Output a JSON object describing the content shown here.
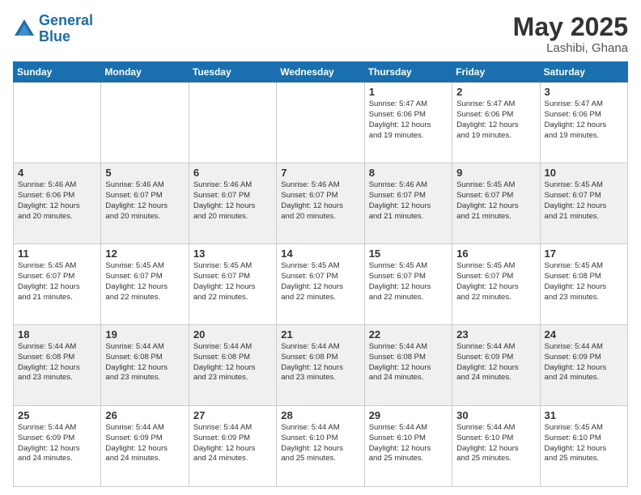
{
  "logo": {
    "line1": "General",
    "line2": "Blue"
  },
  "title": "May 2025",
  "location": "Lashibi, Ghana",
  "days_of_week": [
    "Sunday",
    "Monday",
    "Tuesday",
    "Wednesday",
    "Thursday",
    "Friday",
    "Saturday"
  ],
  "weeks": [
    [
      {
        "day": "",
        "info": ""
      },
      {
        "day": "",
        "info": ""
      },
      {
        "day": "",
        "info": ""
      },
      {
        "day": "",
        "info": ""
      },
      {
        "day": "1",
        "info": "Sunrise: 5:47 AM\nSunset: 6:06 PM\nDaylight: 12 hours\nand 19 minutes."
      },
      {
        "day": "2",
        "info": "Sunrise: 5:47 AM\nSunset: 6:06 PM\nDaylight: 12 hours\nand 19 minutes."
      },
      {
        "day": "3",
        "info": "Sunrise: 5:47 AM\nSunset: 6:06 PM\nDaylight: 12 hours\nand 19 minutes."
      }
    ],
    [
      {
        "day": "4",
        "info": "Sunrise: 5:46 AM\nSunset: 6:06 PM\nDaylight: 12 hours\nand 20 minutes."
      },
      {
        "day": "5",
        "info": "Sunrise: 5:46 AM\nSunset: 6:07 PM\nDaylight: 12 hours\nand 20 minutes."
      },
      {
        "day": "6",
        "info": "Sunrise: 5:46 AM\nSunset: 6:07 PM\nDaylight: 12 hours\nand 20 minutes."
      },
      {
        "day": "7",
        "info": "Sunrise: 5:46 AM\nSunset: 6:07 PM\nDaylight: 12 hours\nand 20 minutes."
      },
      {
        "day": "8",
        "info": "Sunrise: 5:46 AM\nSunset: 6:07 PM\nDaylight: 12 hours\nand 21 minutes."
      },
      {
        "day": "9",
        "info": "Sunrise: 5:45 AM\nSunset: 6:07 PM\nDaylight: 12 hours\nand 21 minutes."
      },
      {
        "day": "10",
        "info": "Sunrise: 5:45 AM\nSunset: 6:07 PM\nDaylight: 12 hours\nand 21 minutes."
      }
    ],
    [
      {
        "day": "11",
        "info": "Sunrise: 5:45 AM\nSunset: 6:07 PM\nDaylight: 12 hours\nand 21 minutes."
      },
      {
        "day": "12",
        "info": "Sunrise: 5:45 AM\nSunset: 6:07 PM\nDaylight: 12 hours\nand 22 minutes."
      },
      {
        "day": "13",
        "info": "Sunrise: 5:45 AM\nSunset: 6:07 PM\nDaylight: 12 hours\nand 22 minutes."
      },
      {
        "day": "14",
        "info": "Sunrise: 5:45 AM\nSunset: 6:07 PM\nDaylight: 12 hours\nand 22 minutes."
      },
      {
        "day": "15",
        "info": "Sunrise: 5:45 AM\nSunset: 6:07 PM\nDaylight: 12 hours\nand 22 minutes."
      },
      {
        "day": "16",
        "info": "Sunrise: 5:45 AM\nSunset: 6:07 PM\nDaylight: 12 hours\nand 22 minutes."
      },
      {
        "day": "17",
        "info": "Sunrise: 5:45 AM\nSunset: 6:08 PM\nDaylight: 12 hours\nand 23 minutes."
      }
    ],
    [
      {
        "day": "18",
        "info": "Sunrise: 5:44 AM\nSunset: 6:08 PM\nDaylight: 12 hours\nand 23 minutes."
      },
      {
        "day": "19",
        "info": "Sunrise: 5:44 AM\nSunset: 6:08 PM\nDaylight: 12 hours\nand 23 minutes."
      },
      {
        "day": "20",
        "info": "Sunrise: 5:44 AM\nSunset: 6:08 PM\nDaylight: 12 hours\nand 23 minutes."
      },
      {
        "day": "21",
        "info": "Sunrise: 5:44 AM\nSunset: 6:08 PM\nDaylight: 12 hours\nand 23 minutes."
      },
      {
        "day": "22",
        "info": "Sunrise: 5:44 AM\nSunset: 6:08 PM\nDaylight: 12 hours\nand 24 minutes."
      },
      {
        "day": "23",
        "info": "Sunrise: 5:44 AM\nSunset: 6:09 PM\nDaylight: 12 hours\nand 24 minutes."
      },
      {
        "day": "24",
        "info": "Sunrise: 5:44 AM\nSunset: 6:09 PM\nDaylight: 12 hours\nand 24 minutes."
      }
    ],
    [
      {
        "day": "25",
        "info": "Sunrise: 5:44 AM\nSunset: 6:09 PM\nDaylight: 12 hours\nand 24 minutes."
      },
      {
        "day": "26",
        "info": "Sunrise: 5:44 AM\nSunset: 6:09 PM\nDaylight: 12 hours\nand 24 minutes."
      },
      {
        "day": "27",
        "info": "Sunrise: 5:44 AM\nSunset: 6:09 PM\nDaylight: 12 hours\nand 24 minutes."
      },
      {
        "day": "28",
        "info": "Sunrise: 5:44 AM\nSunset: 6:10 PM\nDaylight: 12 hours\nand 25 minutes."
      },
      {
        "day": "29",
        "info": "Sunrise: 5:44 AM\nSunset: 6:10 PM\nDaylight: 12 hours\nand 25 minutes."
      },
      {
        "day": "30",
        "info": "Sunrise: 5:44 AM\nSunset: 6:10 PM\nDaylight: 12 hours\nand 25 minutes."
      },
      {
        "day": "31",
        "info": "Sunrise: 5:45 AM\nSunset: 6:10 PM\nDaylight: 12 hours\nand 25 minutes."
      }
    ]
  ]
}
